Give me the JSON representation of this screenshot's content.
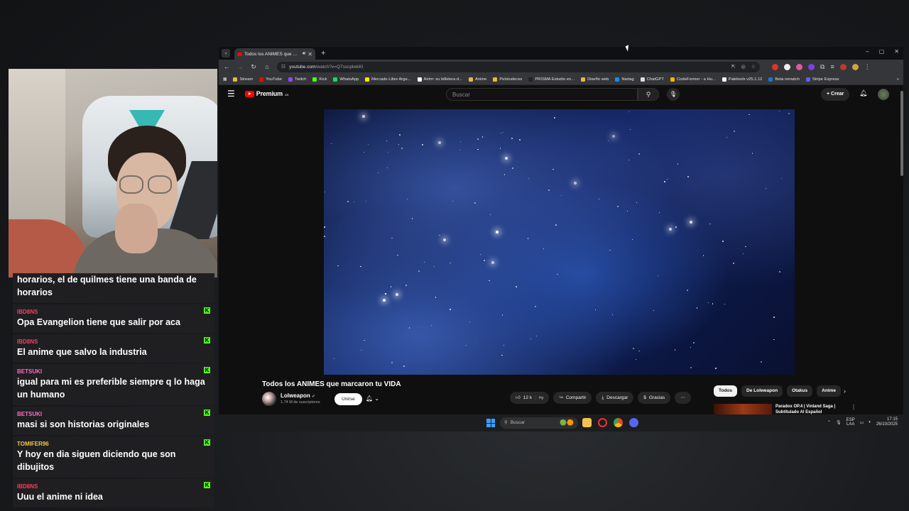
{
  "browser": {
    "tab_title": "Todos los ANIMES que marcaron tu VIDA",
    "url_host": "youtube.com",
    "url_path": "/watch?v=Q7sxcplwkKI",
    "window_controls": [
      "–",
      "▢",
      "✕"
    ],
    "bookmarks": [
      {
        "label": "Stream",
        "color": "#e8b84a"
      },
      {
        "label": "YouTube",
        "color": "#ff0000"
      },
      {
        "label": "Twitch",
        "color": "#9146ff"
      },
      {
        "label": "Kick",
        "color": "#53fc18"
      },
      {
        "label": "WhatsApp",
        "color": "#25d366"
      },
      {
        "label": "Mercado Libre Arge...",
        "color": "#ffe600"
      },
      {
        "label": "Airtm: su billetera d...",
        "color": "#ffffff"
      },
      {
        "label": "Anime",
        "color": "#e8b84a"
      },
      {
        "label": "Pelotudeces",
        "color": "#e8b84a"
      },
      {
        "label": "PRISMA Estudio en...",
        "color": "#222222"
      },
      {
        "label": "Diseño web",
        "color": "#e8b84a"
      },
      {
        "label": "Nartag",
        "color": "#1e88e5"
      },
      {
        "label": "ChatGPT",
        "color": "#dddddd"
      },
      {
        "label": "CodeFormer - a Hu...",
        "color": "#f5b700"
      },
      {
        "label": "Paletools v25.1.12",
        "color": "#ffffff"
      },
      {
        "label": "Beta rematch",
        "color": "#1976d2"
      },
      {
        "label": "Stripe Express",
        "color": "#635bff"
      }
    ]
  },
  "youtube": {
    "logo_text": "Premium",
    "logo_region": "AR",
    "search_placeholder": "Buscar",
    "create_label": "Crear",
    "video_title": "Todos los ANIMES que marcaron tu VIDA",
    "channel_name": "Lolweapon",
    "channel_subs": "1.74 M de suscriptores",
    "join_label": "Unirse",
    "likes": "12 k",
    "share_label": "Compartir",
    "download_label": "Descargar",
    "thanks_label": "Gracias",
    "chips": [
      "Todos",
      "De Lolweapon",
      "Otakus",
      "Anime"
    ],
    "rec_title": "Paradox OP.4 | Vinland Saga | Subtitulado Al Español"
  },
  "chat": {
    "messages": [
      {
        "user": "",
        "user_color": "#ffffff",
        "text": "horarios, el de quilmes tiene una banda de horarios",
        "partial": true,
        "badge": false
      },
      {
        "user": "IBD8NS",
        "user_color": "#ff3b5c",
        "text": "Opa Evangelion tiene que salir por aca",
        "badge": true
      },
      {
        "user": "IBD8NS",
        "user_color": "#ff3b5c",
        "text": "El anime que salvo la industria",
        "badge": true
      },
      {
        "user": "BETSUKI",
        "user_color": "#ff6bc1",
        "text": "igual para mi es preferible siempre q lo haga un humano",
        "badge": true
      },
      {
        "user": "BETSUKI",
        "user_color": "#ff6bc1",
        "text": "masi si son historias originales",
        "badge": true
      },
      {
        "user": "TOMIFER96",
        "user_color": "#f5c542",
        "text": "Y hoy en dia siguen diciendo que son dibujitos",
        "badge": true
      },
      {
        "user": "IBD8NS",
        "user_color": "#ff3b5c",
        "text": "Uuu el anime ni idea",
        "badge": true
      }
    ]
  },
  "taskbar": {
    "search_placeholder": "Buscar",
    "lang_top": "ESP",
    "lang_bottom": "LAA",
    "time": "17:15",
    "date": "26/10/2025"
  }
}
